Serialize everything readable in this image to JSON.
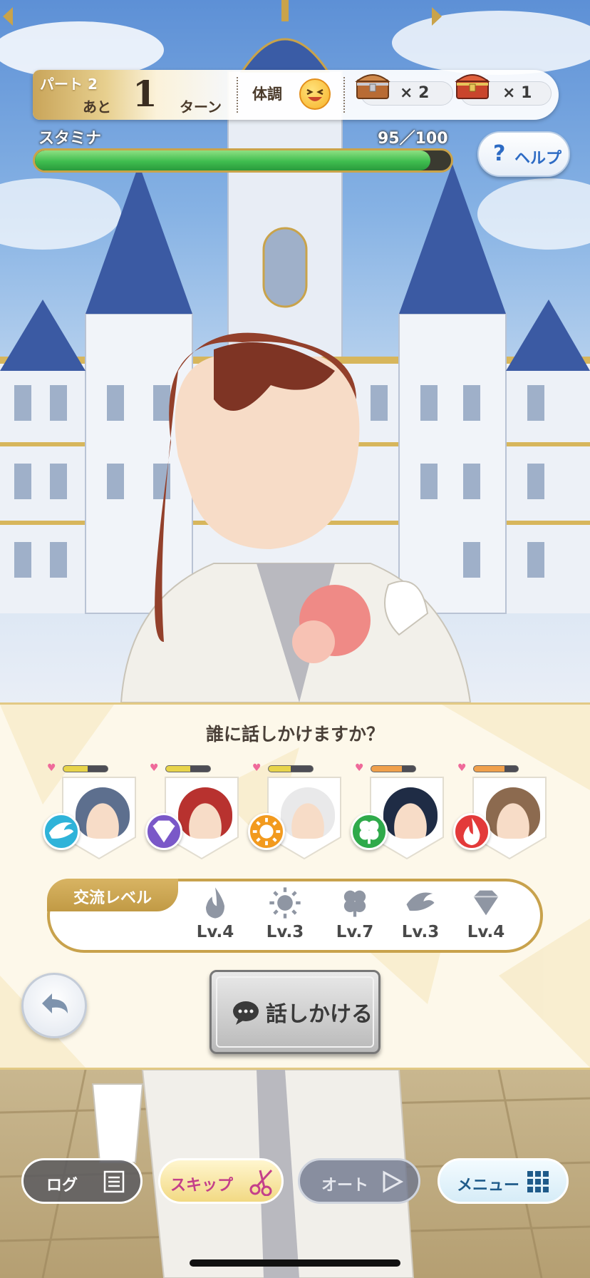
{
  "hud": {
    "part_label": "パート 2",
    "remaining_prefix": "あと",
    "turns_left": "1",
    "turn_suffix": "ターン",
    "condition_label": "体調",
    "condition_icon": "laughing-face-icon",
    "items": [
      {
        "icon": "silver-chest-icon",
        "count_text": "× 2"
      },
      {
        "icon": "gold-chest-icon",
        "count_text": "× 1"
      }
    ]
  },
  "stamina": {
    "label": "スタミナ",
    "value_text": "95／100",
    "current": 95,
    "max": 100
  },
  "help": {
    "label": "ヘルプ"
  },
  "dialog": {
    "question": "誰に話しかけますか？",
    "characters": [
      {
        "hair": "#5d6f8e",
        "attribute": "wind-icon",
        "attribute_color": "#2fb3d9",
        "affection": 0.55,
        "affection_color": "#e8d44a"
      },
      {
        "hair": "#b8322f",
        "attribute": "diamond-icon",
        "attribute_color": "#7a58c8",
        "affection": 0.55,
        "affection_color": "#e8d44a"
      },
      {
        "hair": "#e9e9ea",
        "attribute": "sun-icon",
        "attribute_color": "#f29a1e",
        "affection": 0.5,
        "affection_color": "#e8d44a"
      },
      {
        "hair": "#1f2c45",
        "attribute": "clover-icon",
        "attribute_color": "#2faa4b",
        "affection": 0.7,
        "affection_color": "#f0a04b"
      },
      {
        "hair": "#8c6a4f",
        "attribute": "flame-icon",
        "attribute_color": "#e33a3a",
        "affection": 0.7,
        "affection_color": "#f0a04b"
      }
    ],
    "exchange_level_label": "交流レベル",
    "levels": [
      {
        "icon": "flame-icon",
        "text": "Lv.4"
      },
      {
        "icon": "sun-icon",
        "text": "Lv.3"
      },
      {
        "icon": "clover-icon",
        "text": "Lv.7"
      },
      {
        "icon": "wind-icon",
        "text": "Lv.3"
      },
      {
        "icon": "diamond-icon",
        "text": "Lv.4"
      }
    ],
    "talk_button_label": "話しかける"
  },
  "bottom_bar": {
    "log_label": "ログ",
    "skip_label": "スキップ",
    "auto_label": "オート",
    "menu_label": "メニュー"
  },
  "colors": {
    "gold_accent": "#c8a24c",
    "stamina_green": "#3fbd4f",
    "help_blue": "#2d6bc4"
  }
}
